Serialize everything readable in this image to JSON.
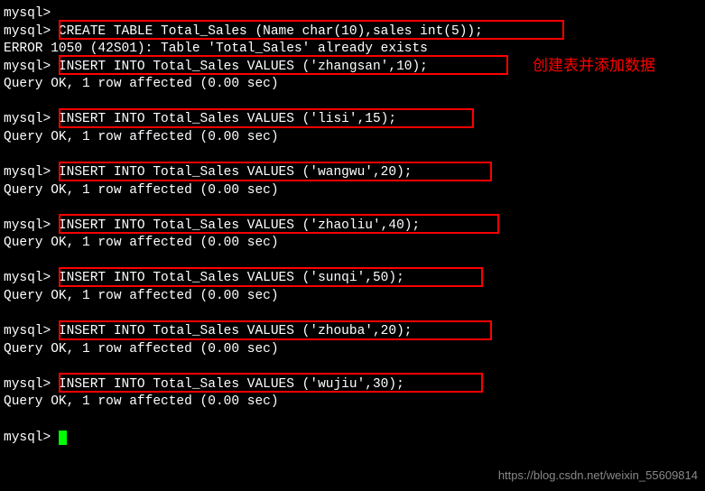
{
  "prompt": "mysql>",
  "lines": {
    "l0": "",
    "createTable": "CREATE TABLE Total_Sales (Name char(10),sales int(5));",
    "error": "ERROR 1050 (42S01): Table 'Total_Sales' already exists",
    "insert1": "INSERT INTO Total_Sales VALUES ('zhangsan',10);",
    "queryOk": "Query OK, 1 row affected (0.00 sec)",
    "insert2": "INSERT INTO Total_Sales VALUES ('lisi',15);",
    "insert3": "INSERT INTO Total_Sales VALUES ('wangwu',20);",
    "insert4": "INSERT INTO Total_Sales VALUES ('zhaoliu',40);",
    "insert5": "INSERT INTO Total_Sales VALUES ('sunqi',50);",
    "insert6": "INSERT INTO Total_Sales VALUES ('zhouba',20);",
    "insert7": "INSERT INTO Total_Sales VALUES ('wujiu',30);"
  },
  "annotation": "创建表并添加数据",
  "watermark": "https://blog.csdn.net/weixin_55609814",
  "chart_data": {
    "type": "table",
    "title": "Total_Sales inserts",
    "columns": [
      "Name",
      "sales"
    ],
    "rows": [
      [
        "zhangsan",
        10
      ],
      [
        "lisi",
        15
      ],
      [
        "wangwu",
        20
      ],
      [
        "zhaoliu",
        40
      ],
      [
        "sunqi",
        50
      ],
      [
        "zhouba",
        20
      ],
      [
        "wujiu",
        30
      ]
    ]
  }
}
